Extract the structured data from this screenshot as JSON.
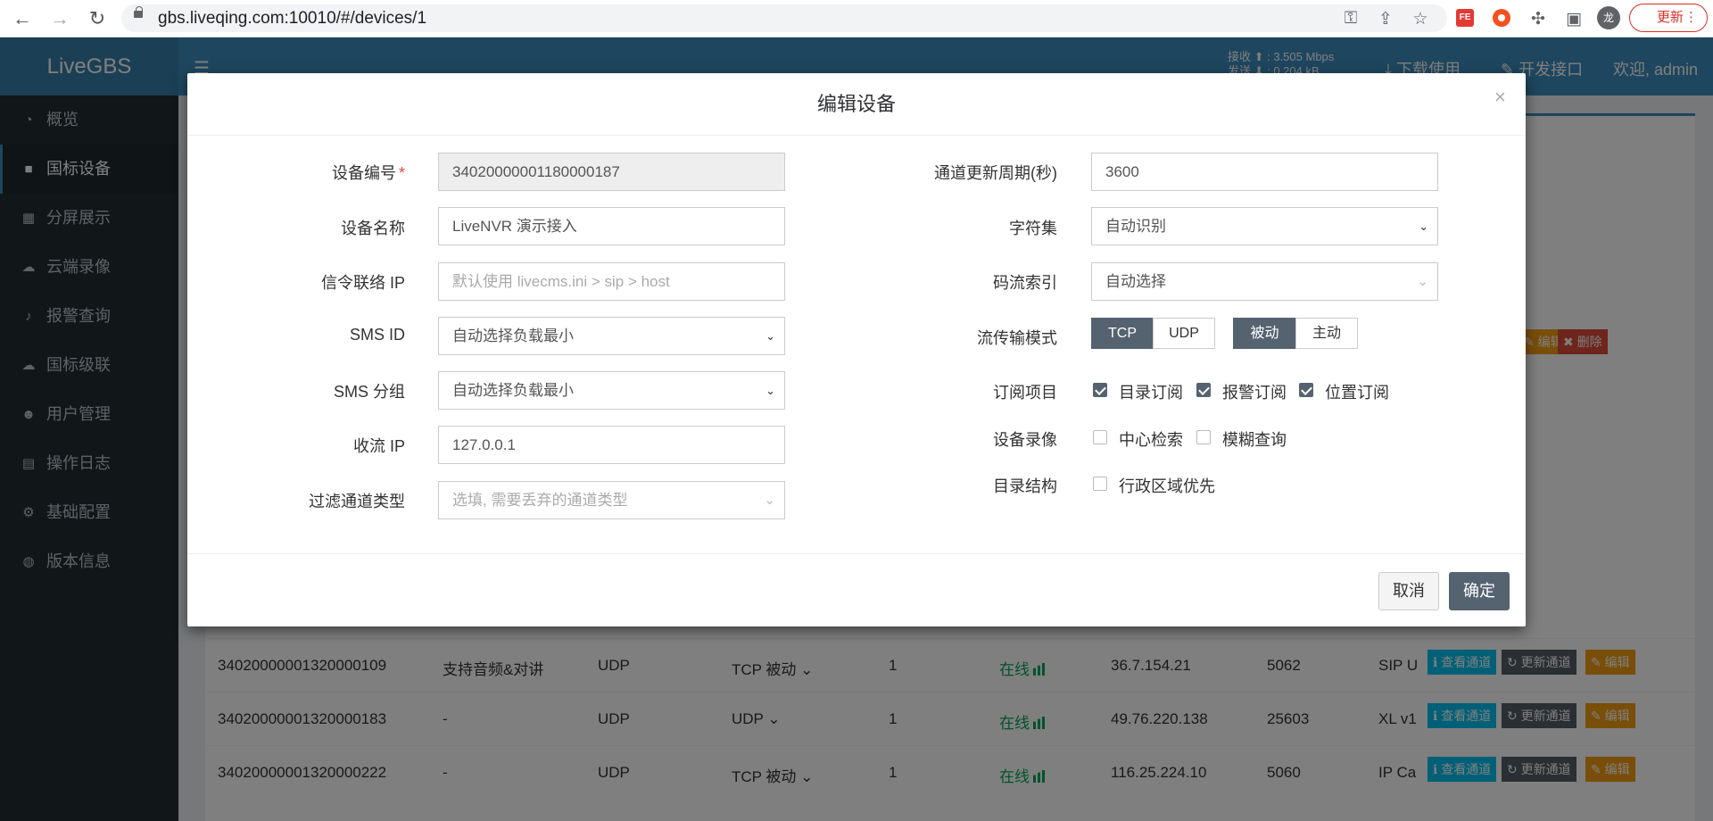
{
  "browser": {
    "url": "gbs.liveqing.com:10010/#/devices/1",
    "update_label": "更新",
    "avatar_text": "龙",
    "ext_fe_label": "FE"
  },
  "header": {
    "logo": "LiveGBS",
    "rate_up": "接收 ⬆ : 3.505 Mbps",
    "rate_down": "发送 ⬇ : 0.204 kB",
    "download": "下载使用",
    "api": "开发接口",
    "welcome": "欢迎, admin"
  },
  "sidebar": {
    "items": [
      {
        "label": "概览",
        "icon": "dashboard-icon"
      },
      {
        "label": "国标设备",
        "icon": "video-camera-icon"
      },
      {
        "label": "分屏展示",
        "icon": "grid-icon"
      },
      {
        "label": "云端录像",
        "icon": "cloud-icon"
      },
      {
        "label": "报警查询",
        "icon": "bell-icon"
      },
      {
        "label": "国标级联",
        "icon": "cloud-upload-icon"
      },
      {
        "label": "用户管理",
        "icon": "users-icon"
      },
      {
        "label": "操作日志",
        "icon": "file-icon"
      },
      {
        "label": "基础配置",
        "icon": "cogs-icon"
      },
      {
        "label": "版本信息",
        "icon": "globe-icon"
      }
    ]
  },
  "table": {
    "rows": [
      {
        "id": "34020000001320000109",
        "name": "支持音频&对讲",
        "sig": "UDP",
        "stream": "TCP 被动",
        "ch": "1",
        "status": "在线",
        "ip": "36.7.154.21",
        "port": "5062",
        "vendor": "SIP U"
      },
      {
        "id": "34020000001320000183",
        "name": "-",
        "sig": "UDP",
        "stream": "UDP",
        "ch": "1",
        "status": "在线",
        "ip": "49.76.220.138",
        "port": "25603",
        "vendor": "XL v1"
      },
      {
        "id": "34020000001320000222",
        "name": "-",
        "sig": "UDP",
        "stream": "TCP 被动",
        "ch": "1",
        "status": "在线",
        "ip": "116.25.224.10",
        "port": "5060",
        "vendor": "IP Ca"
      }
    ],
    "btn_view": "查看通道",
    "btn_update": "更新通道",
    "btn_edit": "编辑",
    "btn_delete": "删除"
  },
  "modal": {
    "title": "编辑设备",
    "close": "×",
    "left": {
      "device_id_label": "设备编号",
      "device_id_value": "34020000001180000187",
      "device_name_label": "设备名称",
      "device_name_value": "LiveNVR 演示接入",
      "sig_ip_label": "信令联络 IP",
      "sig_ip_placeholder": "默认使用 livecms.ini > sip > host",
      "sms_id_label": "SMS ID",
      "sms_id_value": "自动选择负载最小",
      "sms_group_label": "SMS 分组",
      "sms_group_value": "自动选择负载最小",
      "recv_ip_label": "收流 IP",
      "recv_ip_value": "127.0.0.1",
      "filter_label": "过滤通道类型",
      "filter_placeholder": "选填, 需要丢弃的通道类型"
    },
    "right": {
      "period_label": "通道更新周期(秒)",
      "period_value": "3600",
      "charset_label": "字符集",
      "charset_value": "自动识别",
      "stream_index_label": "码流索引",
      "stream_index_value": "自动选择",
      "transport_label": "流传输模式",
      "transport_tcp": "TCP",
      "transport_udp": "UDP",
      "transport_passive": "被动",
      "transport_active": "主动",
      "subscribe_label": "订阅项目",
      "sub_catalog": "目录订阅",
      "sub_alarm": "报警订阅",
      "sub_position": "位置订阅",
      "record_label": "设备录像",
      "rec_center": "中心检索",
      "rec_fuzzy": "模糊查询",
      "catalog_label": "目录结构",
      "cat_region": "行政区域优先"
    },
    "cancel": "取消",
    "ok": "确定"
  }
}
